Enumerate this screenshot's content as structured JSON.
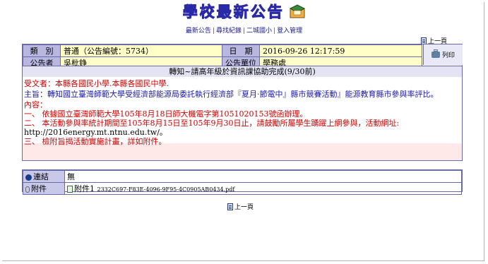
{
  "header": {
    "site_title": "學校最新公告",
    "icon": "envelope-icon"
  },
  "nav": {
    "items": [
      "最新公告",
      "尋找紀錄",
      "二城國小",
      "登入管理"
    ],
    "separator": "|"
  },
  "prev_page_label": "上一頁",
  "notice": {
    "type_label": "類　別",
    "type_value": "普通（公告編號：5734）",
    "date_label": "日　期",
    "date_value": "2016-09-26 12:17:59",
    "announcer_label": "公告者",
    "announcer_value": "吳枇錚",
    "unit_label": "公告單位",
    "unit_value": "學務處",
    "print_label": "列印",
    "subject": "轉知~請高年級於資訊課協助完成(9/30前)",
    "body_lines": [
      "受文者：本縣各國民小學.本縣各國民中學.",
      "主旨：轉知國立臺灣師範大學受經濟部能源局委託執行經濟部『夏月·節電中』縣市競賽活動』能源教育縣市參與率評比。",
      "內容：",
      "一、 依據國立臺灣師範大學105年8月18日師大機電字第1051020153號函辦理。",
      "二、 本活動參與率統計期間至105年8月15日至105年9月30日止，請鼓勵所屬學生踴躍上網參與，活動網址:",
      "http://2016energy.mt.ntnu.edu.tw/。",
      "三、 檢附旨揭活動實施計畫，詳如附件。"
    ]
  },
  "attachments": {
    "link_label": "連結",
    "link_value": "無",
    "file_label": "附件",
    "file_name": "附件1",
    "file_id": "2332C697-F83E-4096-9F95-4C0905AB0434.pdf"
  },
  "colors": {
    "label_bg": "#b7b7e0",
    "value_bg": "#ffffc8",
    "border": "#6a6aa8",
    "recipient_red": "#cc0000",
    "subject_blue": "#1a1aa8"
  }
}
